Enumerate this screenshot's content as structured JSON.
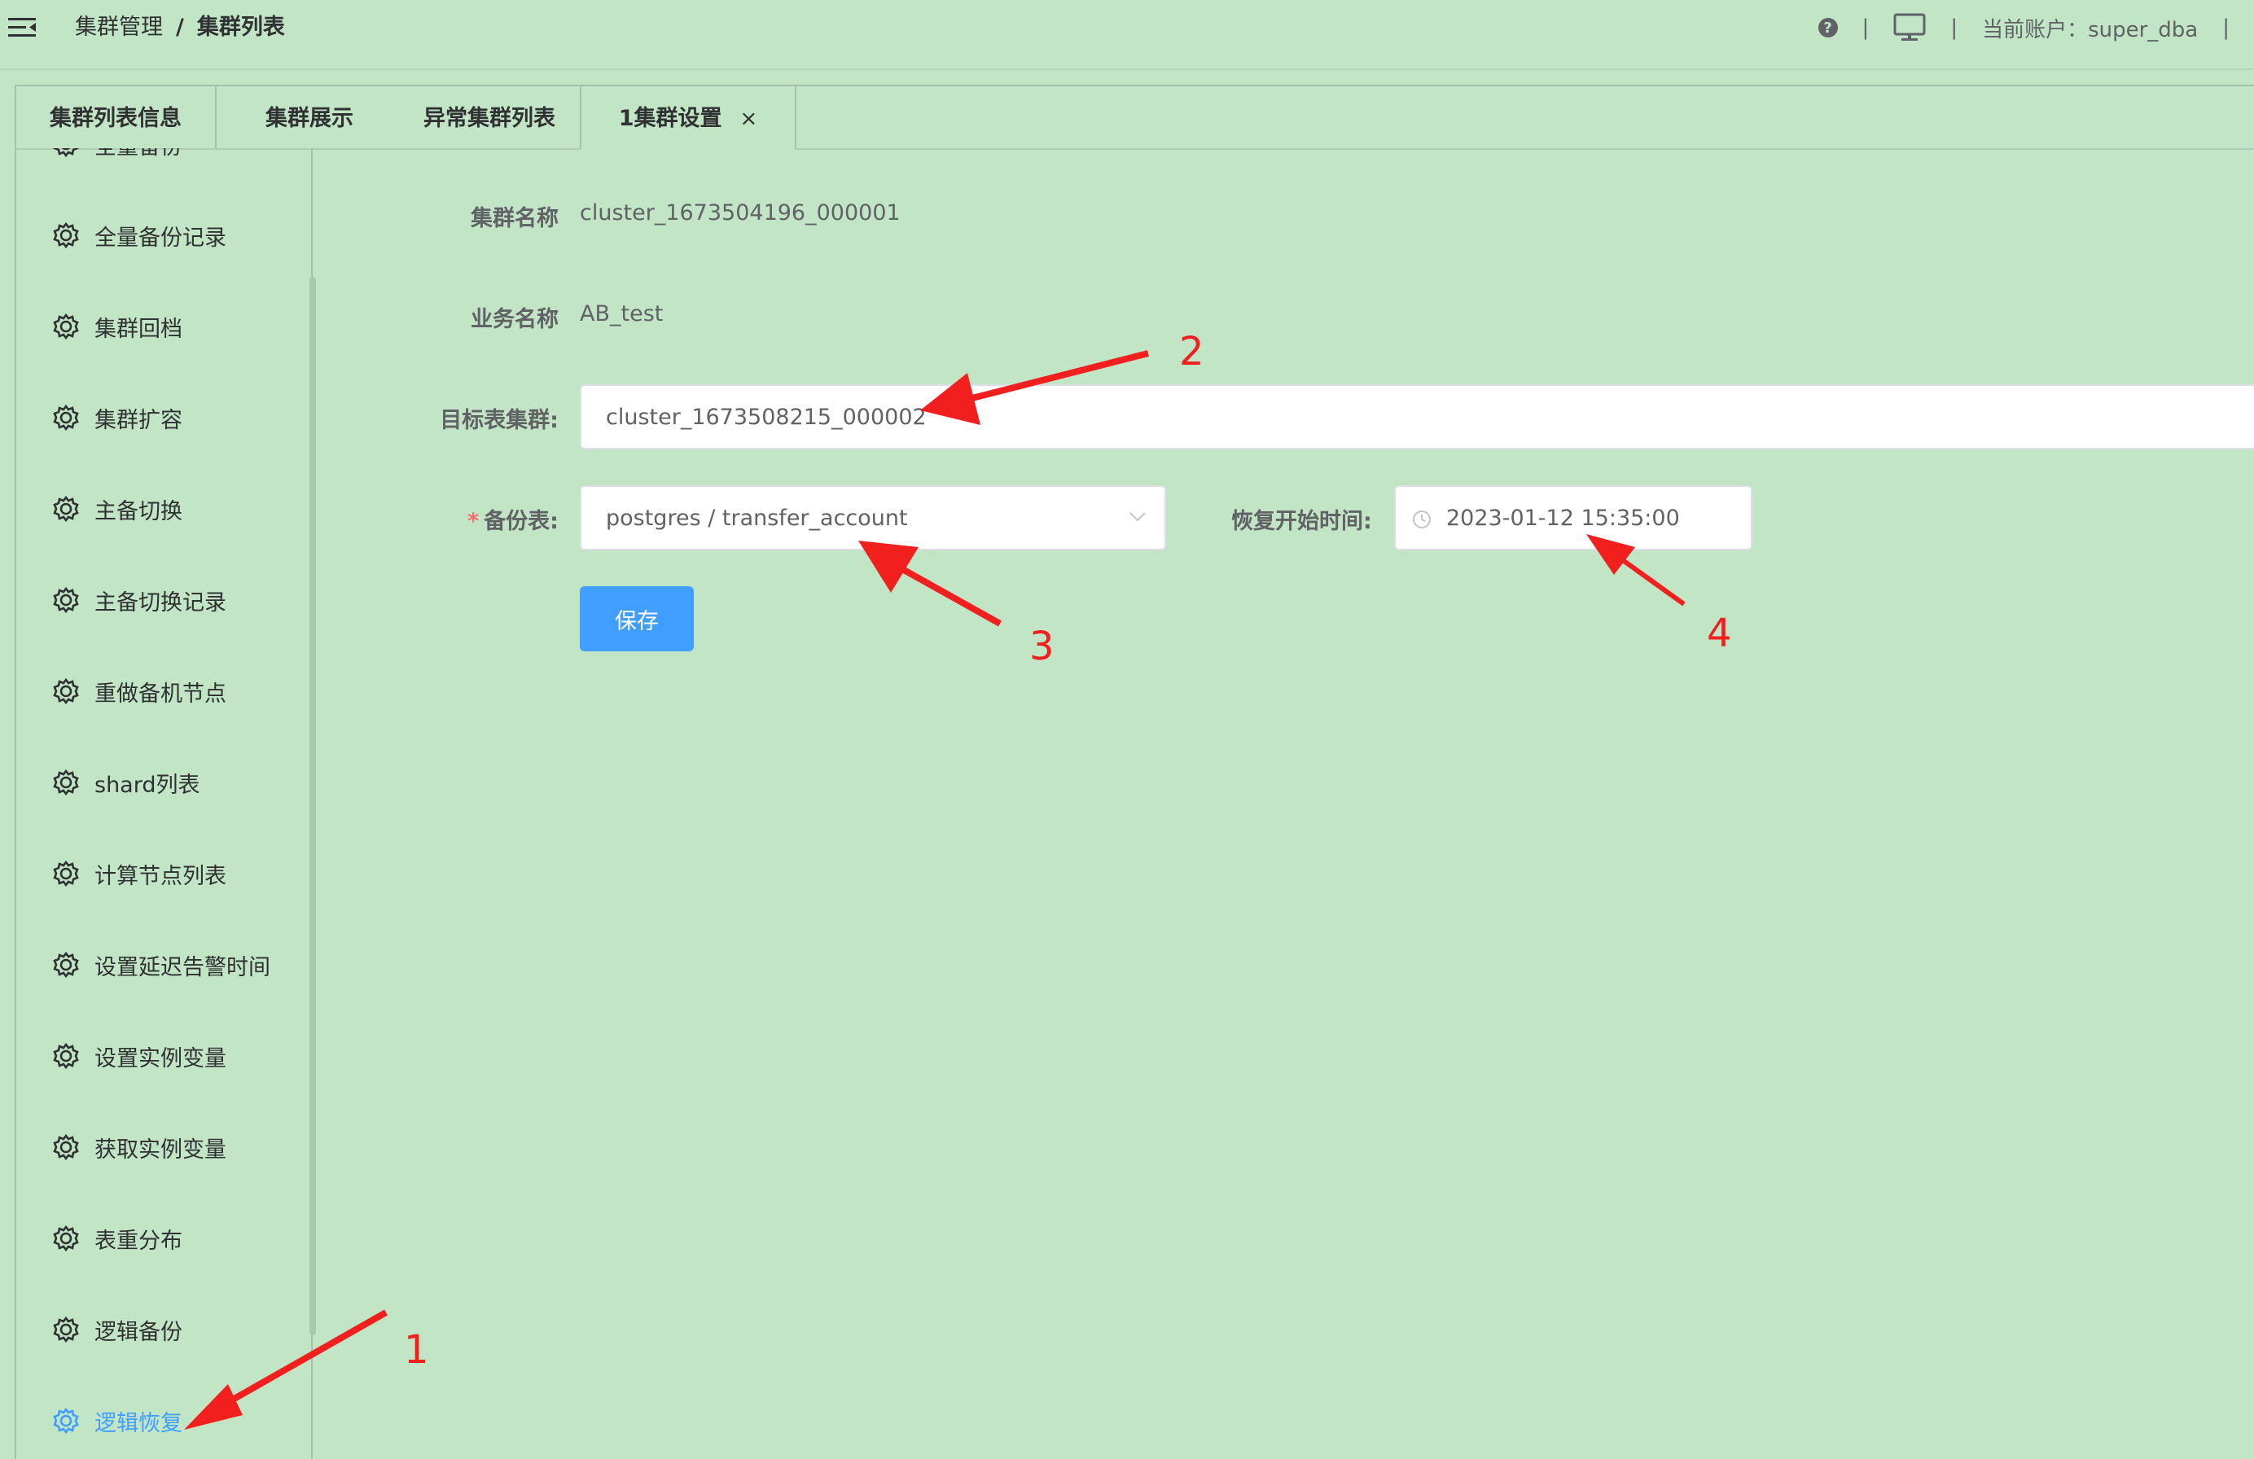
{
  "header": {
    "breadcrumb": [
      "集群管理",
      "集群列表"
    ],
    "separator": "/",
    "pipe": "|",
    "account": "当前账户：super_dba"
  },
  "tabs": [
    {
      "label": "集群列表信息"
    },
    {
      "label": "集群展示"
    },
    {
      "label": "异常集群列表"
    },
    {
      "label": "1集群设置",
      "close": "×"
    }
  ],
  "sidebar": {
    "items": [
      {
        "label": "全量备份"
      },
      {
        "label": "全量备份记录"
      },
      {
        "label": "集群回档"
      },
      {
        "label": "集群扩容"
      },
      {
        "label": "主备切换"
      },
      {
        "label": "主备切换记录"
      },
      {
        "label": "重做备机节点"
      },
      {
        "label": "shard列表"
      },
      {
        "label": "计算节点列表"
      },
      {
        "label": "设置延迟告警时间"
      },
      {
        "label": "设置实例变量"
      },
      {
        "label": "获取实例变量"
      },
      {
        "label": "表重分布"
      },
      {
        "label": "逻辑备份"
      },
      {
        "label": "逻辑恢复"
      }
    ],
    "active_color": "#409eff"
  },
  "form": {
    "cluster_name_label": "集群名称",
    "cluster_name_value": "cluster_1673504196_000001",
    "business_name_label": "业务名称",
    "business_name_value": "AB_test",
    "target_cluster_label": "目标表集群:",
    "target_cluster_value": "cluster_1673508215_000002",
    "backup_table_required": "*",
    "backup_table_label": "备份表:",
    "backup_table_value": "postgres / transfer_account",
    "restore_time_label": "恢复开始时间:",
    "restore_time_value": "2023-01-12 15:35:00",
    "save_button": "保存"
  },
  "annotations": [
    "1",
    "2",
    "3",
    "4"
  ],
  "colors": {
    "background": "#c2e5c5",
    "primary": "#409eff",
    "annotation": "#f21f1f"
  }
}
